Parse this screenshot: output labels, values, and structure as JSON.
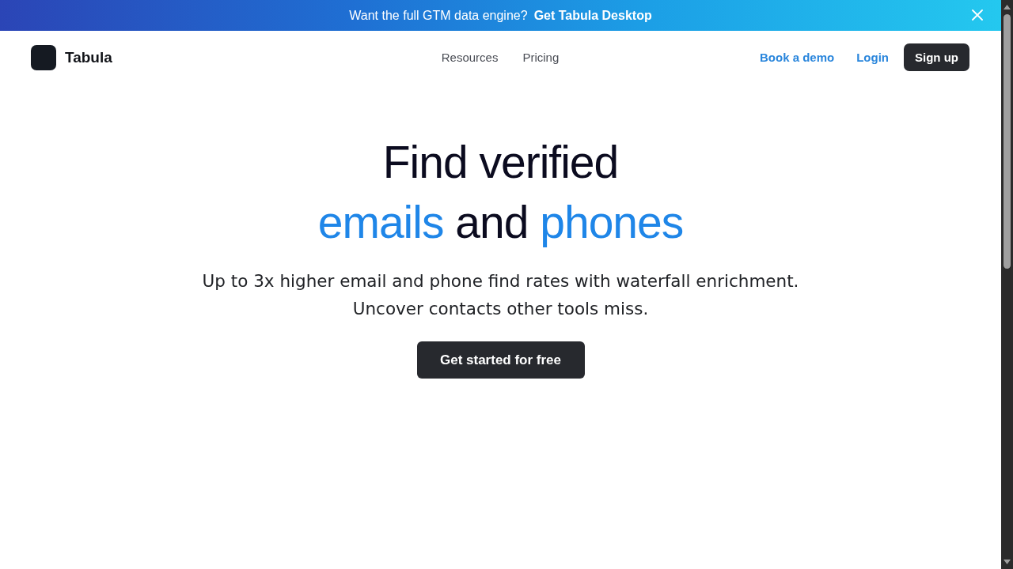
{
  "banner": {
    "text": "Want the full GTM data engine?",
    "link": "Get Tabula Desktop"
  },
  "nav": {
    "brand": "Tabula",
    "links": [
      {
        "label": "Resources"
      },
      {
        "label": "Pricing"
      }
    ],
    "actions": [
      {
        "label": "Book a demo",
        "kind": "link"
      },
      {
        "label": "Login",
        "kind": "link"
      },
      {
        "label": "Sign up",
        "kind": "button"
      }
    ]
  },
  "hero": {
    "title": [
      [
        {
          "text": "Find verified",
          "highlight": false
        }
      ],
      [
        {
          "text": "emails",
          "highlight": true
        },
        {
          "text": "and",
          "highlight": false
        },
        {
          "text": "phones",
          "highlight": true
        }
      ]
    ],
    "subtitle": [
      "Up to 3x higher email and phone find rates with waterfall enrichment.",
      "Uncover contacts other tools miss."
    ],
    "cta": "Get started for free"
  }
}
